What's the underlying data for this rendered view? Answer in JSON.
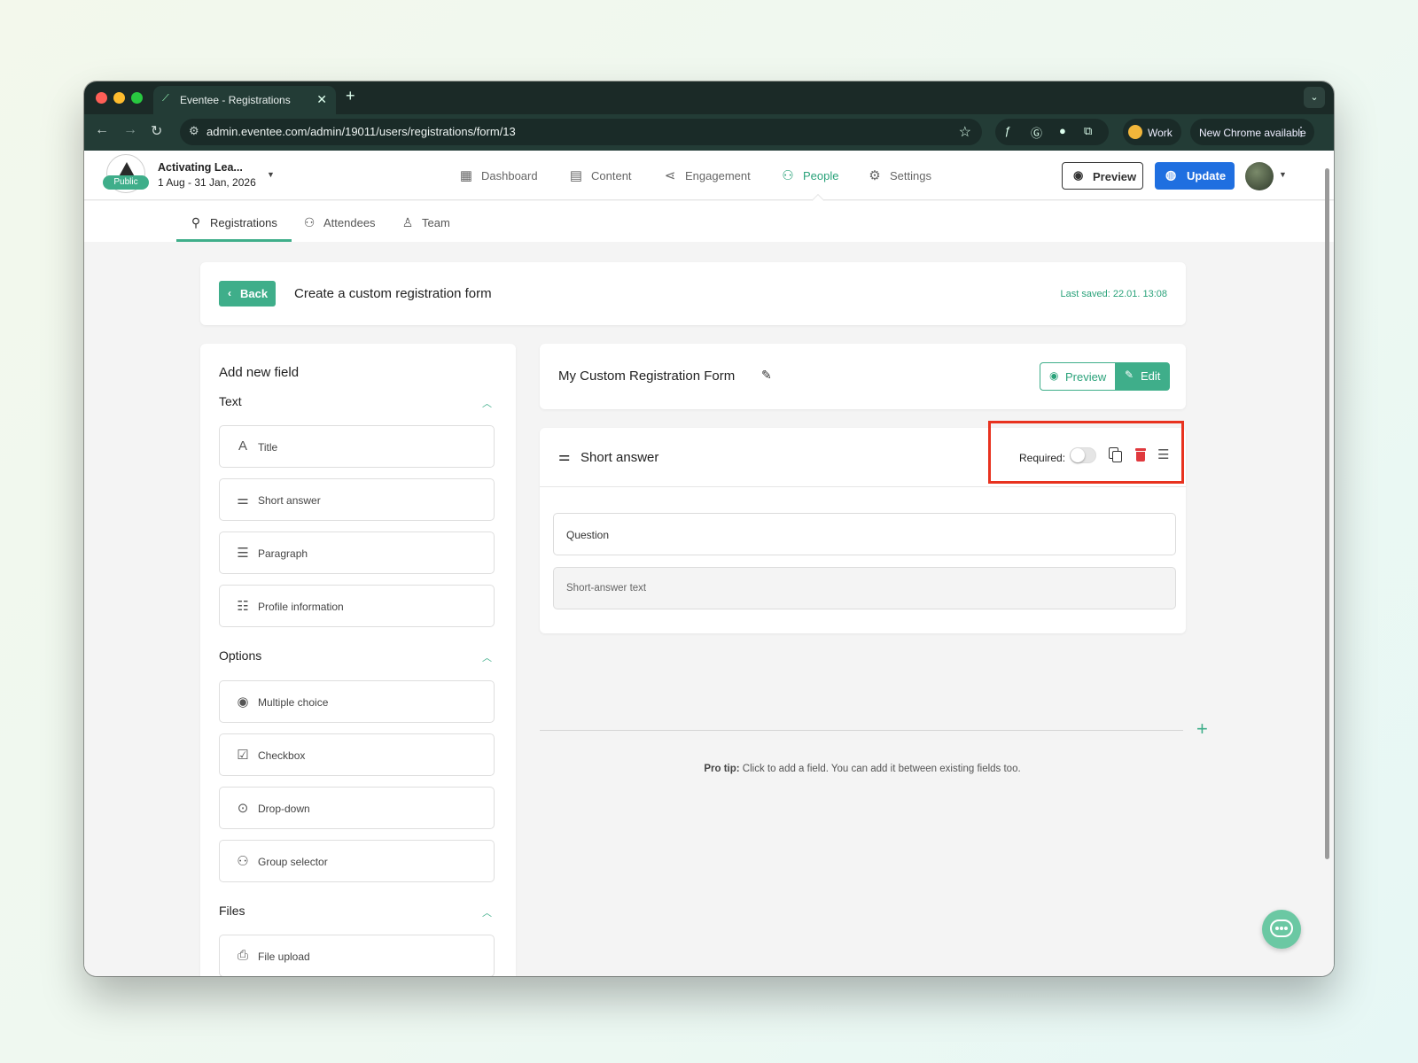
{
  "browser": {
    "tab_title": "Eventee - Registrations",
    "tab_close": "✕",
    "new_tab": "+",
    "url": "admin.eventee.com/admin/19011/users/registrations/form/13",
    "profile_label": "Work",
    "update_notice": "New Chrome available"
  },
  "event": {
    "name": "Activating Lea...",
    "dates": "1 Aug - 31 Jan, 2026",
    "status_badge": "Public"
  },
  "main_nav": {
    "items": [
      {
        "label": "Dashboard",
        "icon": "dashboard-icon",
        "active": false
      },
      {
        "label": "Content",
        "icon": "calendar-icon",
        "active": false
      },
      {
        "label": "Engagement",
        "icon": "share-icon",
        "active": false
      },
      {
        "label": "People",
        "icon": "people-icon",
        "active": true
      },
      {
        "label": "Settings",
        "icon": "gear-icon",
        "active": false
      }
    ],
    "preview_label": "Preview",
    "update_label": "Update"
  },
  "sub_nav": {
    "items": [
      {
        "label": "Registrations",
        "icon": "user-check-icon",
        "active": true
      },
      {
        "label": "Attendees",
        "icon": "attendees-icon",
        "active": false
      },
      {
        "label": "Team",
        "icon": "team-icon",
        "active": false
      }
    ]
  },
  "header": {
    "back_label": "Back",
    "title": "Create a custom registration form",
    "last_saved": "Last saved: 22.01. 13:08"
  },
  "sidebar": {
    "title": "Add new field",
    "groups": [
      {
        "label": "Text",
        "items": [
          {
            "label": "Title",
            "icon": "letter-a-icon"
          },
          {
            "label": "Short answer",
            "icon": "short-lines-icon"
          },
          {
            "label": "Paragraph",
            "icon": "paragraph-icon"
          },
          {
            "label": "Profile information",
            "icon": "profile-info-icon"
          }
        ]
      },
      {
        "label": "Options",
        "items": [
          {
            "label": "Multiple choice",
            "icon": "radio-icon"
          },
          {
            "label": "Checkbox",
            "icon": "checkbox-icon"
          },
          {
            "label": "Drop-down",
            "icon": "dropdown-icon"
          },
          {
            "label": "Group selector",
            "icon": "group-icon"
          }
        ]
      },
      {
        "label": "Files",
        "items": [
          {
            "label": "File upload",
            "icon": "file-upload-icon"
          }
        ]
      }
    ]
  },
  "form": {
    "title": "My Custom Registration Form",
    "preview_label": "Preview",
    "edit_label": "Edit",
    "field": {
      "type_label": "Short answer",
      "required_label": "Required:",
      "required": false,
      "question_placeholder": "Question",
      "answer_placeholder": "Short-answer text"
    },
    "pro_tip_label": "Pro tip:",
    "pro_tip_text": " Click to add a field. You can add it between existing fields too."
  },
  "colors": {
    "accent": "#3fae8a",
    "primary_blue": "#1f6fe0",
    "danger": "#e0393e",
    "highlight_box": "#e8321f",
    "browser_chrome": "#233c36"
  }
}
